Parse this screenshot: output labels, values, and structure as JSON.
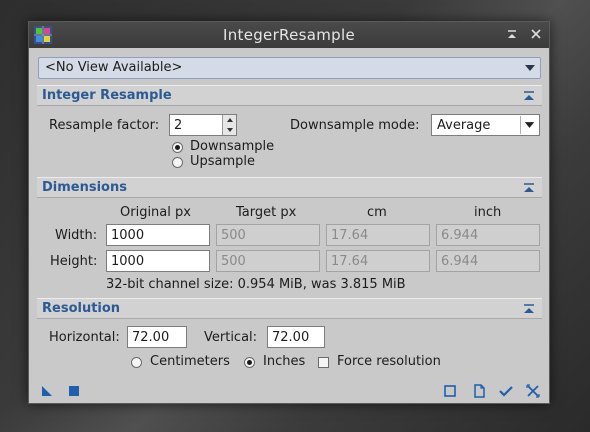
{
  "window": {
    "title": "IntegerResample"
  },
  "view_selector": {
    "value": "<No View Available>"
  },
  "integer_resample": {
    "section_title": "Integer Resample",
    "resample_factor_label": "Resample factor:",
    "resample_factor_value": "2",
    "downsample_mode_label": "Downsample mode:",
    "downsample_mode_value": "Average",
    "downsample_label": "Downsample",
    "upsample_label": "Upsample",
    "selected_direction": "downsample"
  },
  "dimensions": {
    "section_title": "Dimensions",
    "headers": {
      "original": "Original px",
      "target": "Target px",
      "cm": "cm",
      "inch": "inch"
    },
    "width_label": "Width:",
    "height_label": "Height:",
    "width": {
      "original": "1000",
      "target": "500",
      "cm": "17.64",
      "inch": "6.944"
    },
    "height": {
      "original": "1000",
      "target": "500",
      "cm": "17.64",
      "inch": "6.944"
    },
    "channel_size_text": "32-bit channel size: 0.954 MiB, was 3.815 MiB"
  },
  "resolution": {
    "section_title": "Resolution",
    "horizontal_label": "Horizontal:",
    "horizontal_value": "72.00",
    "vertical_label": "Vertical:",
    "vertical_value": "72.00",
    "centimeters_label": "Centimeters",
    "inches_label": "Inches",
    "force_resolution_label": "Force resolution",
    "selected_unit": "inches",
    "force_resolution_checked": false
  },
  "icons": {
    "app": "integer-resample-icon",
    "shade": "shade-icon",
    "close": "close-icon",
    "new_instance": "new-instance-triangle-icon",
    "apply_global": "apply-global-square-icon",
    "browse_doc": "browse-documentation-icon",
    "edit_instance": "edit-instance-icon",
    "apply": "apply-checkmark-icon",
    "reset": "reset-icon"
  },
  "colors": {
    "section_title": "#2c5a94",
    "accent_icon": "#1f5fae"
  }
}
